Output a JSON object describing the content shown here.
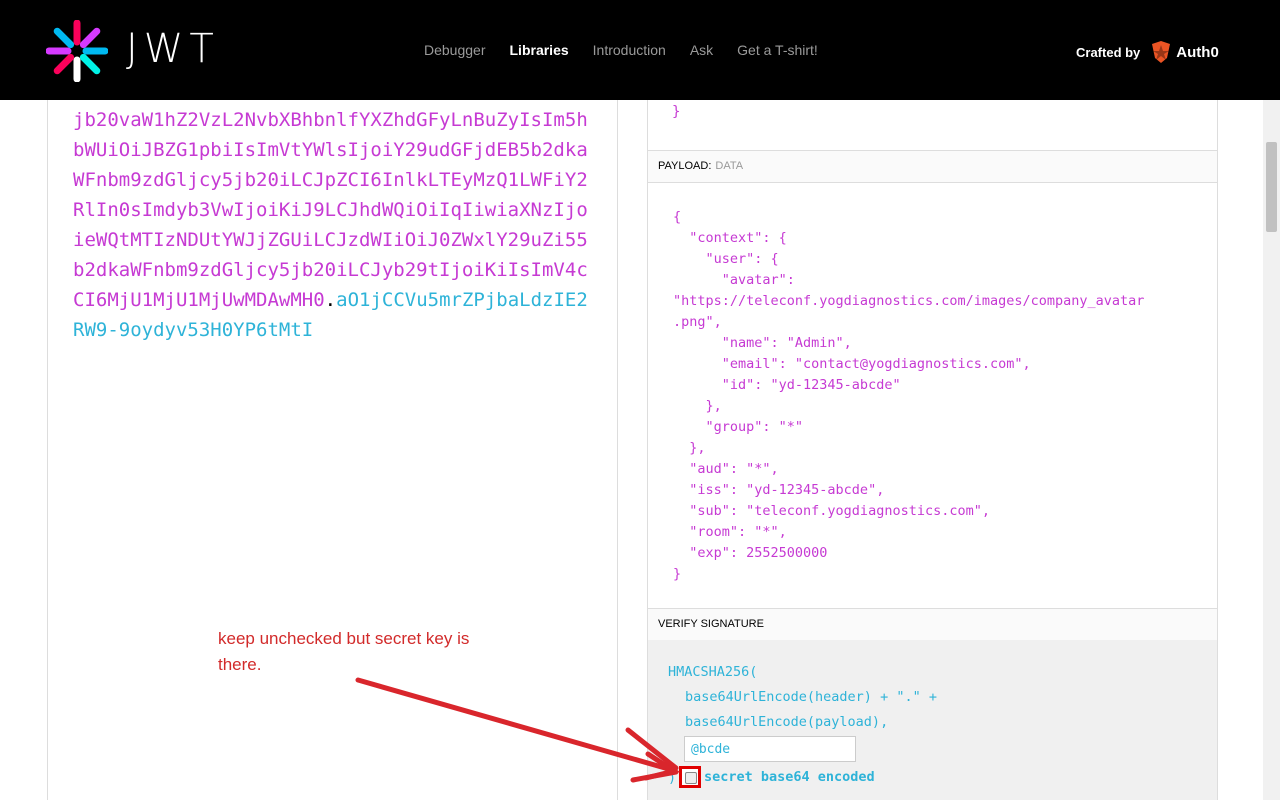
{
  "header": {
    "logo_text": "JWT",
    "nav": [
      {
        "label": "Debugger",
        "active": false
      },
      {
        "label": "Libraries",
        "active": true
      },
      {
        "label": "Introduction",
        "active": false
      },
      {
        "label": "Ask",
        "active": false
      },
      {
        "label": "Get a T-shirt!",
        "active": false
      }
    ],
    "crafted_by": "Crafted by",
    "brand": "Auth0"
  },
  "encoded": {
    "payload_part": "jb20vaW1hZ2VzL2NvbXBhbnlfYXZhdGFyLnBuZyIsIm5hbWUiOiJBZG1pbiIsImVtYWlsIjoiY29udGFjdEB5b2dkaWFnbm9zdGljcy5jb20iLCJpZCI6InlkLTEyMzQ1LWFiY2RlIn0sImdyb3VwIjoiKiJ9LCJhdWQiOiIqIiwiaXNzIjoieWQtMTIzNDUtYWJjZGUiLCJzdWIiOiJ0ZWxlY29uZi55b2dkaWFnbm9zdGljcy5jb20iLCJyb29tIjoiKiIsImV4cCI6MjU1MjU1MjUwMDAwMH0",
    "dot": ".",
    "signature_part": "aO1jCCVu5mrZPjbaLdzIE2RW9-9oydyv53H0YP6tMtI"
  },
  "decoded": {
    "prev_tail": "}",
    "payload_header": "PAYLOAD:",
    "payload_sub": "DATA",
    "payload_json": "{\n  \"context\": {\n    \"user\": {\n      \"avatar\":\n\"https://teleconf.yogdiagnostics.com/images/company_avatar\n.png\",\n      \"name\": \"Admin\",\n      \"email\": \"contact@yogdiagnostics.com\",\n      \"id\": \"yd-12345-abcde\"\n    },\n    \"group\": \"*\"\n  },\n  \"aud\": \"*\",\n  \"iss\": \"yd-12345-abcde\",\n  \"sub\": \"teleconf.yogdiagnostics.com\",\n  \"room\": \"*\",\n  \"exp\": 2552500000\n}",
    "verify_header": "VERIFY SIGNATURE",
    "verify_lines": [
      "HMACSHA256(",
      "base64UrlEncode(header) + \".\" +",
      "base64UrlEncode(payload),"
    ],
    "secret_value": "@bcde",
    "secret_closing": ")",
    "base64_label": "secret base64 encoded",
    "base64_checked": false
  },
  "annotation": {
    "text": "keep unchecked but secret key is there.",
    "color": "#d22a2a"
  },
  "colors": {
    "payload": "#c63ad3",
    "signature": "#2eb3d8"
  }
}
